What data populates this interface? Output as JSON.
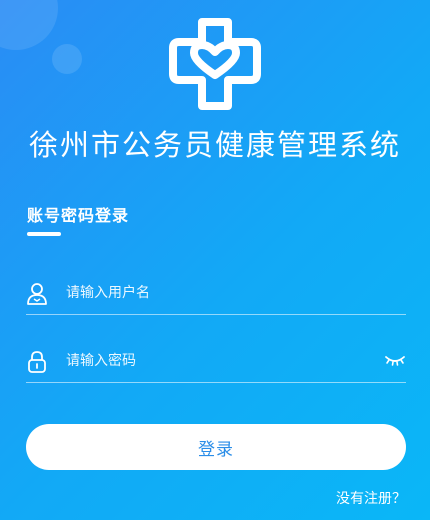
{
  "app": {
    "title": "徐州市公务员健康管理系统"
  },
  "login_tab": {
    "label": "账号密码登录"
  },
  "username": {
    "placeholder": "请输入用户名",
    "value": ""
  },
  "password": {
    "placeholder": "请输入密码",
    "value": ""
  },
  "login_button": {
    "label": "登录"
  },
  "register_link": {
    "label": "没有注册？"
  },
  "icons": {
    "logo": "medical-cross-heart-icon",
    "username": "user-icon",
    "password": "lock-icon",
    "toggle": "eye-closed-icon"
  },
  "colors": {
    "background_start": "#2a8cf5",
    "background_end": "#0ab7f7",
    "button_background": "#ffffff",
    "button_text": "#2a8de8",
    "text": "#ffffff"
  }
}
